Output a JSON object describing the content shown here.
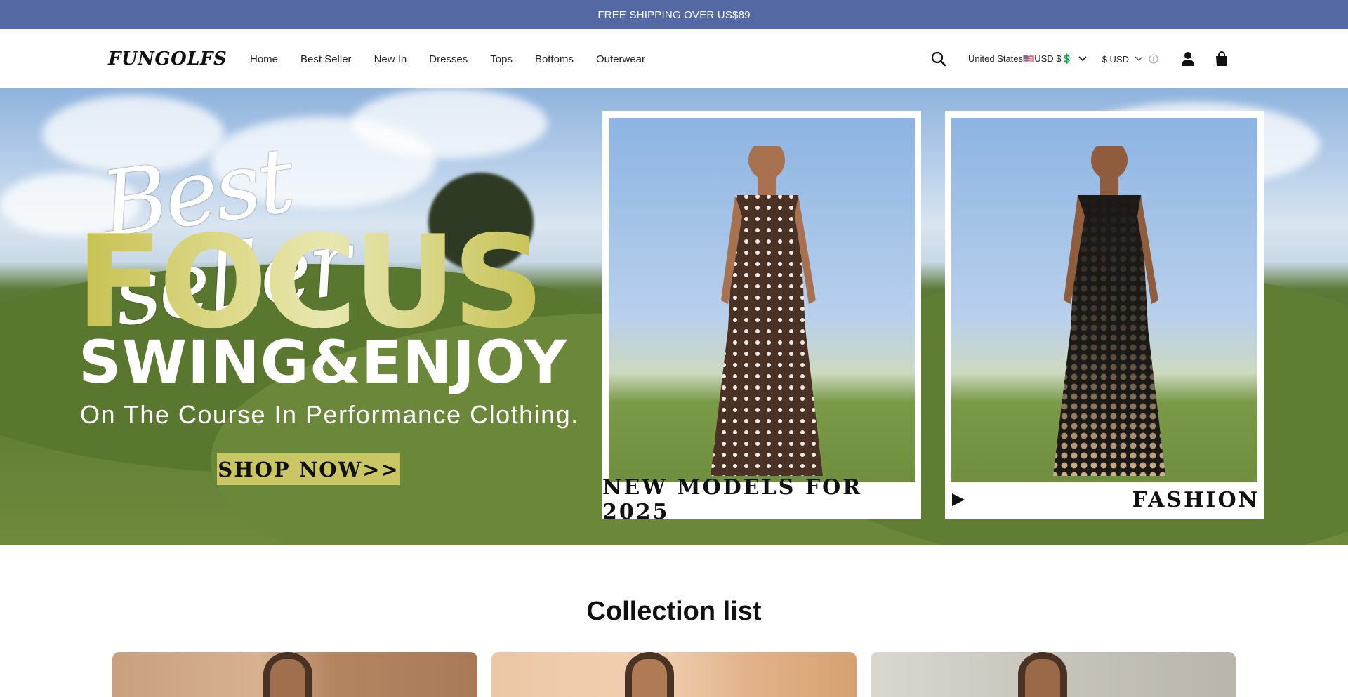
{
  "announcement": {
    "text": "FREE SHIPPING OVER US$89"
  },
  "header": {
    "logo_text": "FUNGOLFS",
    "nav": [
      "Home",
      "Best Seller",
      "New In",
      "Dresses",
      "Tops",
      "Bottoms",
      "Outerwear"
    ],
    "country_selector": "United States🇺🇸USD $💲",
    "currency_selector": "$ USD",
    "icons": [
      "search-icon",
      "chevron-down-icon",
      "info-icon",
      "account-icon",
      "cart-icon"
    ]
  },
  "hero": {
    "script_title": "Best seller",
    "headline": "FOCUS",
    "subheadline": "SWING&ENJOY",
    "tagline": "On The Course In Performance Clothing.",
    "cta": "SHOP NOW>>",
    "cards": [
      {
        "label": "NEW MODELS FOR 2025",
        "pattern": "polka-dot"
      },
      {
        "label": "FASHION",
        "pattern": "gradient-dot",
        "icon": "play-icon"
      }
    ],
    "colors": {
      "accent": "#c9c663",
      "announcement_bg": "#5469a3"
    }
  },
  "collection": {
    "title": "Collection list",
    "items": 3
  }
}
